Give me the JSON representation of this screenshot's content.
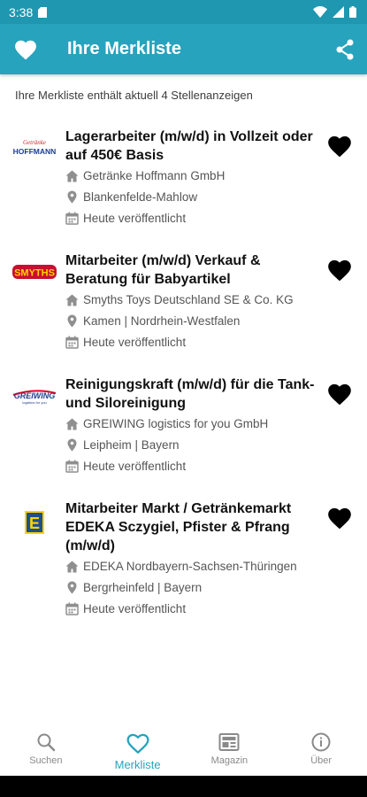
{
  "status": {
    "time": "3:38"
  },
  "appbar": {
    "title": "Ihre Merkliste"
  },
  "summary": "Ihre Merkliste enthält aktuell 4 Stellenanzeigen",
  "jobs": [
    {
      "title": "Lagerarbeiter (m/w/d) in Vollzeit oder auf 450€ Basis",
      "company": "Getränke Hoffmann GmbH",
      "location": "Blankenfelde-Mahlow",
      "published": "Heute veröffentlicht",
      "logo_text": "HOFFMANN",
      "logo_sub": "Getränke"
    },
    {
      "title": "Mitarbeiter (m/w/d) Verkauf & Beratung für Babyartikel",
      "company": "Smyths Toys Deutschland SE & Co. KG",
      "location": "Kamen | Nordrhein-Westfalen",
      "published": "Heute veröffentlicht",
      "logo_text": "SMYTHS"
    },
    {
      "title": "Reinigungskraft (m/w/d) für die Tank- und Siloreinigung",
      "company": "GREIWING logistics for you GmbH",
      "location": "Leipheim | Bayern",
      "published": "Heute veröffentlicht",
      "logo_text": "GREIWING",
      "logo_sub": "logistics for you"
    },
    {
      "title": "Mitarbeiter Markt / Getränkemarkt EDEKA Sczygiel, Pfister & Pfrang (m/w/d)",
      "company": "EDEKA Nordbayern-Sachsen-Thüringen",
      "location": "Bergrheinfeld | Bayern",
      "published": "Heute veröffentlicht",
      "logo_text": "E"
    }
  ],
  "nav": {
    "search": "Suchen",
    "favorites": "Merkliste",
    "magazine": "Magazin",
    "about": "Über"
  },
  "colors": {
    "primary": "#27a3bd",
    "statusbar": "#1f97b0"
  }
}
